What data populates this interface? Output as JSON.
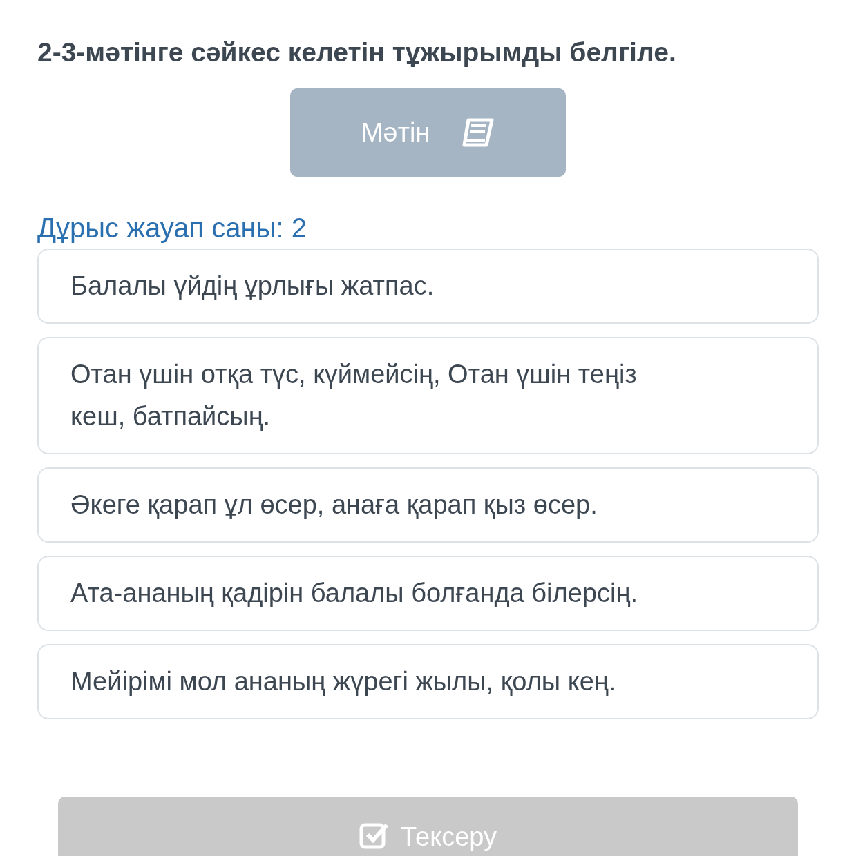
{
  "question": {
    "title": "2-3-мәтінге сәйкес келетін тұжырымды белгіле."
  },
  "text_button": {
    "label": "Мәтін"
  },
  "answer_count": "Дұрыс жауап саны: 2",
  "options": [
    {
      "text": "Балалы үйдің ұрлығы жатпас.",
      "selected": false
    },
    {
      "text": "Отан үшін отқа түс, күймейсің, Отан үшін теңіз кеш, батпайсың.",
      "selected": false
    },
    {
      "text": "Әкеге қарап ұл өсер, анаға қарап қыз өсер.",
      "selected": false
    },
    {
      "text": "Ата-ананың қадірін балалы болғанда білерсің.",
      "selected": false
    },
    {
      "text": "Мейірімі мол ананың жүрегі жылы, қолы кең.",
      "selected": false
    }
  ],
  "check_button": {
    "label": "Тексеру",
    "disabled": true
  }
}
